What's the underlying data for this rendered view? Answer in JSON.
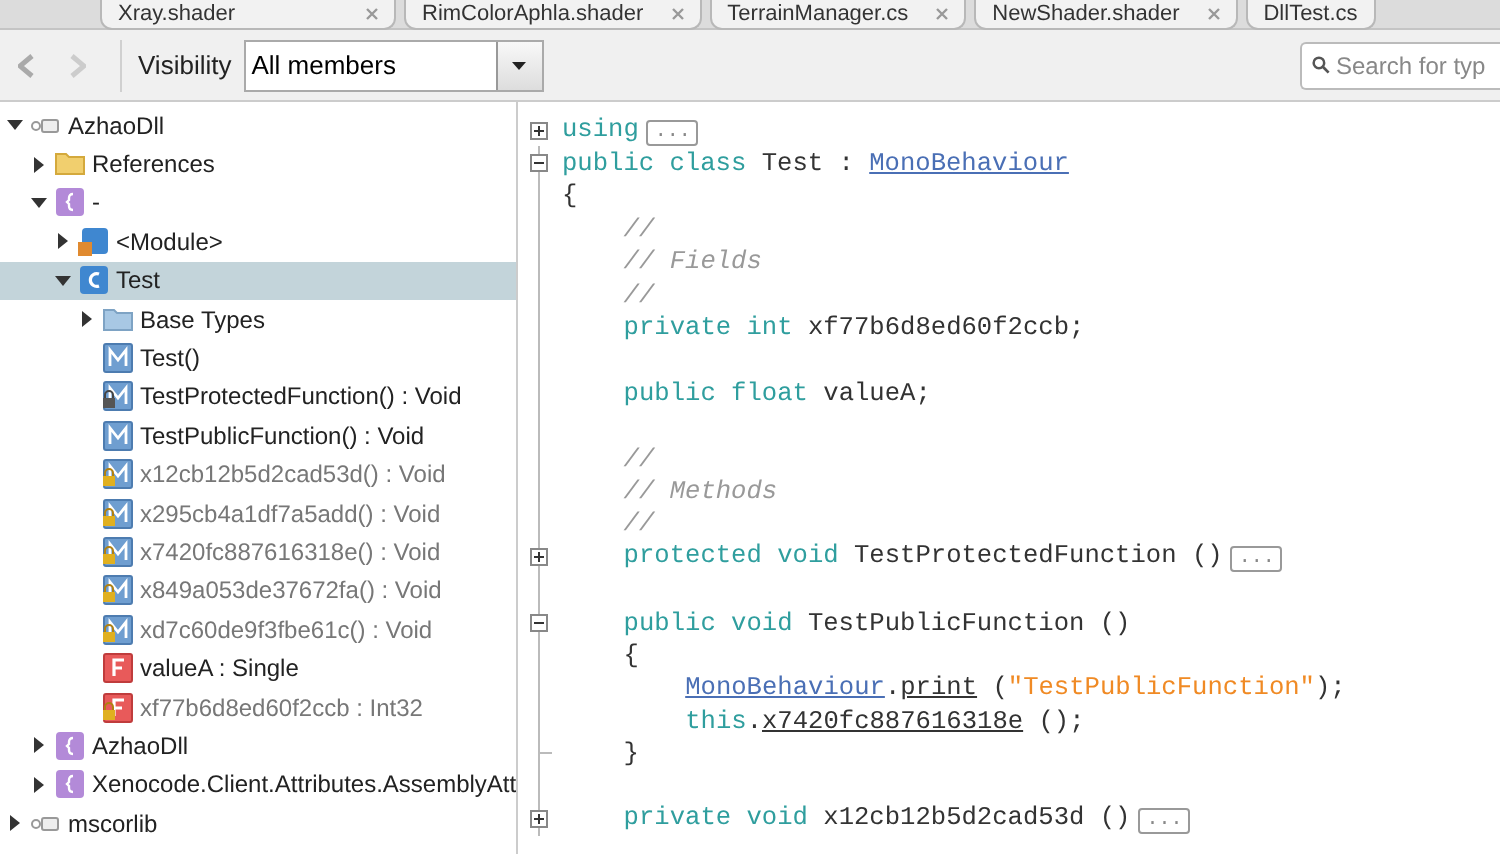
{
  "tabs": [
    {
      "label": "Xray.shader",
      "closable": true
    },
    {
      "label": "RimColorAphla.shader",
      "closable": true
    },
    {
      "label": "TerrainManager.cs",
      "closable": true
    },
    {
      "label": "NewShader.shader",
      "closable": true
    },
    {
      "label": "DllTest.cs",
      "closable": false
    }
  ],
  "toolbar": {
    "visibility_label": "Visibility",
    "visibility_value": "All members",
    "search_placeholder": "Search for typ"
  },
  "tree": [
    {
      "label": "AzhaoDll",
      "kind": "assembly",
      "expanded": true,
      "selected": false,
      "children": [
        {
          "label": "References",
          "kind": "folder",
          "expanded": false,
          "selected": false
        },
        {
          "label": "-",
          "kind": "namespace",
          "expanded": true,
          "selected": false,
          "children": [
            {
              "label": "<Module>",
              "kind": "module",
              "expanded": false,
              "selected": false
            },
            {
              "label": "Test",
              "kind": "class",
              "expanded": true,
              "selected": true,
              "children": [
                {
                  "label": "Base Types",
                  "kind": "basetypes",
                  "expanded": false,
                  "selected": false
                },
                {
                  "label": "Test()",
                  "kind": "method",
                  "selected": false
                },
                {
                  "label": "TestProtectedFunction() : Void",
                  "kind": "protected-method",
                  "selected": false
                },
                {
                  "label": "TestPublicFunction() : Void",
                  "kind": "method",
                  "selected": false
                },
                {
                  "label": "x12cb12b5d2cad53d() : Void",
                  "kind": "private-method",
                  "selected": false
                },
                {
                  "label": "x295cb4a1df7a5add() : Void",
                  "kind": "private-method",
                  "selected": false
                },
                {
                  "label": "x7420fc887616318e() : Void",
                  "kind": "private-method",
                  "selected": false
                },
                {
                  "label": "x849a053de37672fa() : Void",
                  "kind": "private-method",
                  "selected": false
                },
                {
                  "label": "xd7c60de9f3fbe61c() : Void",
                  "kind": "private-method",
                  "selected": false
                },
                {
                  "label": "valueA : Single",
                  "kind": "field",
                  "selected": false
                },
                {
                  "label": "xf77b6d8ed60f2ccb : Int32",
                  "kind": "private-field",
                  "selected": false
                }
              ]
            }
          ]
        },
        {
          "label": "AzhaoDll",
          "kind": "namespace",
          "expanded": false,
          "selected": false
        },
        {
          "label": "Xenocode.Client.Attributes.AssemblyAtt",
          "kind": "namespace",
          "expanded": false,
          "selected": false
        }
      ]
    },
    {
      "label": "mscorlib",
      "kind": "assembly",
      "expanded": false,
      "selected": false
    }
  ],
  "code": [
    {
      "kind": "code",
      "folded": true,
      "tokens": [
        {
          "kind": "keyword",
          "text": "using"
        },
        {
          "kind": "collapsed",
          "text": "..."
        }
      ]
    },
    {
      "kind": "code",
      "folded": false,
      "tokens": [
        {
          "kind": "keyword",
          "text": "public class "
        },
        {
          "kind": "plain",
          "text": "Test : "
        },
        {
          "kind": "link",
          "text": "MonoBehaviour"
        }
      ]
    },
    {
      "kind": "code",
      "tokens": [
        {
          "kind": "plain",
          "text": "{"
        }
      ],
      "children": [
        {
          "kind": "code",
          "tokens": [
            {
              "kind": "comment",
              "text": "//"
            }
          ]
        },
        {
          "kind": "code",
          "tokens": [
            {
              "kind": "comment",
              "text": "// Fields"
            }
          ]
        },
        {
          "kind": "code",
          "tokens": [
            {
              "kind": "comment",
              "text": "//"
            }
          ]
        },
        {
          "kind": "code",
          "tokens": [
            {
              "kind": "keyword",
              "text": "private int "
            },
            {
              "kind": "plain",
              "text": "xf77b6d8ed60f2ccb;"
            }
          ]
        },
        {
          "kind": "blank"
        },
        {
          "kind": "code",
          "tokens": [
            {
              "kind": "keyword",
              "text": "public float "
            },
            {
              "kind": "plain",
              "text": "valueA;"
            }
          ]
        },
        {
          "kind": "blank"
        },
        {
          "kind": "code",
          "tokens": [
            {
              "kind": "comment",
              "text": "//"
            }
          ]
        },
        {
          "kind": "code",
          "tokens": [
            {
              "kind": "comment",
              "text": "// Methods"
            }
          ]
        },
        {
          "kind": "code",
          "tokens": [
            {
              "kind": "comment",
              "text": "//"
            }
          ]
        },
        {
          "kind": "code",
          "folded": true,
          "tokens": [
            {
              "kind": "keyword",
              "text": "protected void "
            },
            {
              "kind": "plain",
              "text": "TestProtectedFunction ()"
            },
            {
              "kind": "collapsed",
              "text": "..."
            }
          ]
        },
        {
          "kind": "blank"
        },
        {
          "kind": "code",
          "folded": false,
          "tokens": [
            {
              "kind": "keyword",
              "text": "public void "
            },
            {
              "kind": "plain",
              "text": "TestPublicFunction ()"
            }
          ]
        },
        {
          "kind": "code",
          "tokens": [
            {
              "kind": "plain",
              "text": "{"
            }
          ],
          "children": [
            {
              "kind": "code",
              "tokens": [
                {
                  "kind": "link",
                  "text": "MonoBehaviour"
                },
                {
                  "kind": "plain",
                  "text": "."
                },
                {
                  "kind": "member",
                  "text": "print"
                },
                {
                  "kind": "plain",
                  "text": " ("
                },
                {
                  "kind": "string",
                  "text": "\"TestPublicFunction\""
                },
                {
                  "kind": "plain",
                  "text": ");"
                }
              ]
            },
            {
              "kind": "code",
              "tokens": [
                {
                  "kind": "keyword",
                  "text": "this"
                },
                {
                  "kind": "plain",
                  "text": "."
                },
                {
                  "kind": "member",
                  "text": "x7420fc887616318e"
                },
                {
                  "kind": "plain",
                  "text": " ();"
                }
              ]
            }
          ]
        },
        {
          "kind": "end",
          "tokens": [
            {
              "kind": "plain",
              "text": "}"
            }
          ]
        },
        {
          "kind": "blank"
        },
        {
          "kind": "code",
          "folded": true,
          "tokens": [
            {
              "kind": "keyword",
              "text": "private void "
            },
            {
              "kind": "plain",
              "text": "x12cb12b5d2cad53d ()"
            },
            {
              "kind": "collapsed",
              "text": "..."
            }
          ]
        }
      ]
    }
  ]
}
